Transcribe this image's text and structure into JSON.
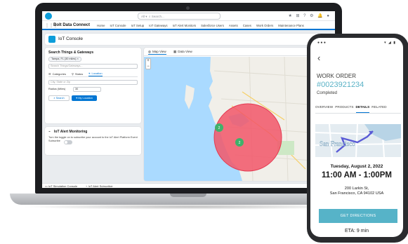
{
  "colors": {
    "brand_blue": "#0176d3",
    "cloud_blue": "#0d9dda",
    "teal": "#56b3c8",
    "alert_circle": "#f25668",
    "marker_green": "#3fb16a"
  },
  "salesforce": {
    "search_scope": "All",
    "search_placeholder": "Search...",
    "app_name": "Bolt Data Connect",
    "nav_items": [
      {
        "label": "Home"
      },
      {
        "label": "IoT Console"
      },
      {
        "label": "IoT Setup"
      },
      {
        "label": "IoT Gateways"
      },
      {
        "label": "IoT Alert Monitors"
      },
      {
        "label": "Salesforce Users"
      },
      {
        "label": "Assets"
      },
      {
        "label": "Cases"
      },
      {
        "label": "Work Orders"
      },
      {
        "label": "Maintenance Plans"
      }
    ],
    "page_title": "IoT Console",
    "search_card": {
      "title": "Search Things & Gateways",
      "pill": "Tampa, FL (30 miles)",
      "input_placeholder": "Search Things/Gateways...",
      "tabs": [
        {
          "label": "Categories",
          "icon": "list-icon"
        },
        {
          "label": "Status",
          "icon": "filter-icon"
        },
        {
          "label": "Location",
          "icon": "location-pin-icon"
        }
      ],
      "location_placeholder": "City, State or Zip",
      "radius_label": "Radius (Miles)",
      "radius_value": "30",
      "search_button": "Search",
      "locate_button": "My Location"
    },
    "alert_card": {
      "title": "IoT Alert Monitoring",
      "description": "Turn the toggle on to subscribe your account to the IoT Alert Platform Event",
      "subscribe_label": "Subscribe"
    },
    "map_tabs": [
      {
        "label": "Map View",
        "icon": "globe-icon"
      },
      {
        "label": "Data View",
        "icon": "grid-icon"
      }
    ],
    "markers": [
      "2",
      "2"
    ],
    "footer_items": [
      {
        "label": "IoT Simulation Console",
        "icon": "device-icon"
      },
      {
        "label": "IoT Alert Subscriber",
        "icon": "bell-icon"
      }
    ]
  },
  "phone": {
    "back_icon": "back-chevron-icon",
    "work_order_label": "WORK ORDER",
    "work_order_number": "#0023921234",
    "status": "Completed",
    "tabs": [
      "OVERVIEW",
      "PRODUCTS",
      "DETAILS",
      "RELATED"
    ],
    "active_tab": "DETAILS",
    "map_label": "San Francisco",
    "date": "Tuesday, August 2, 2022",
    "time": "11:00 AM - 1:00PM",
    "address_line1": "200 Larkin St,",
    "address_line2": "San Francisco, CA 94102 USA",
    "directions_button": "GET DIRECTIONS",
    "eta": "ETA: 9 min"
  }
}
